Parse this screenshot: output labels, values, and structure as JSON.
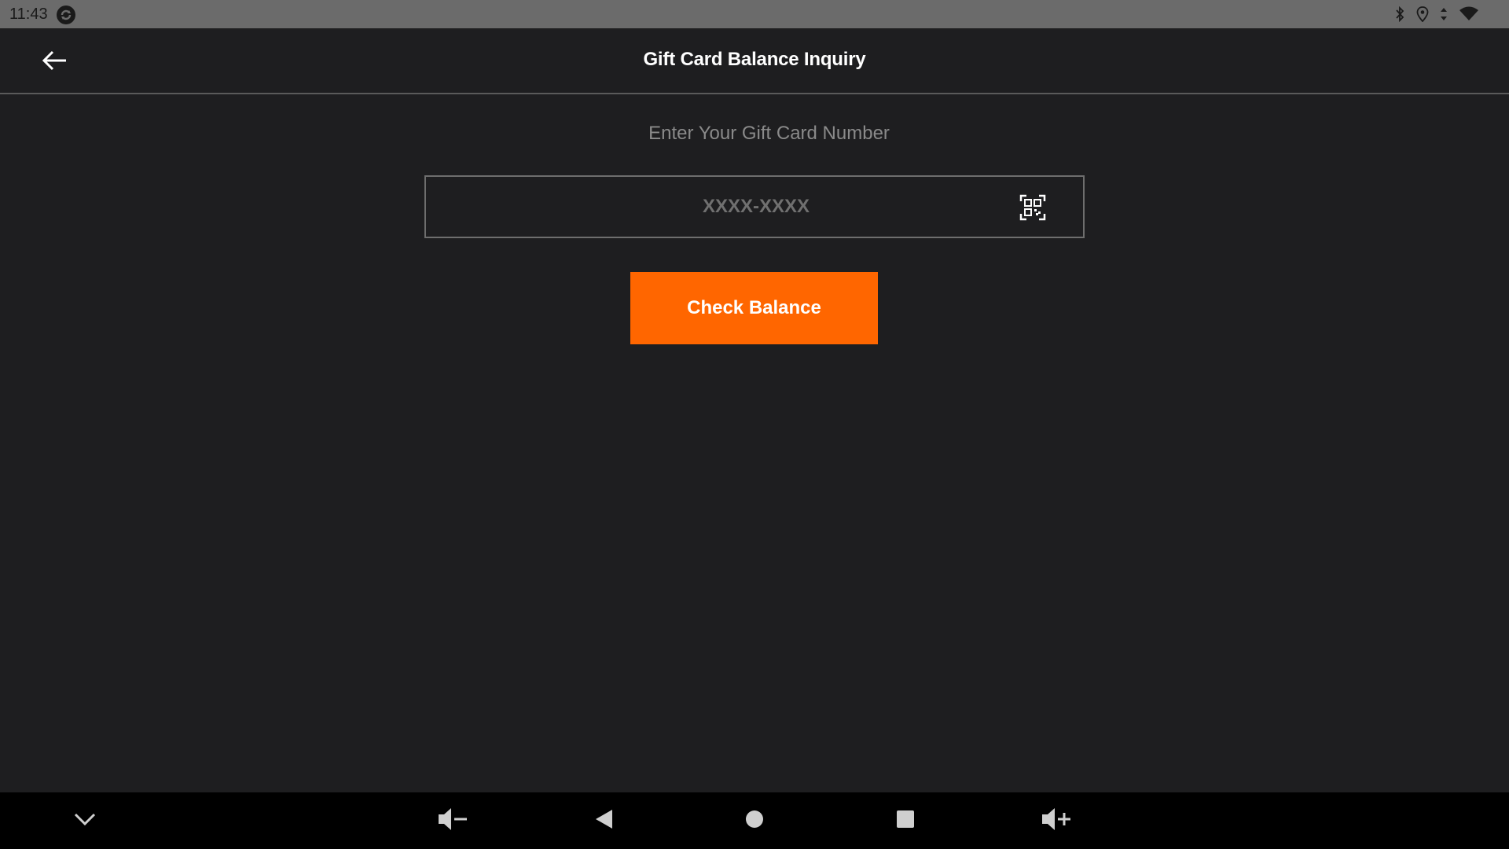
{
  "status_bar": {
    "time": "11:43",
    "icons": [
      "sync-app-icon",
      "bluetooth-icon",
      "location-icon",
      "data-arrows-icon",
      "wifi-icon"
    ]
  },
  "header": {
    "title": "Gift Card Balance Inquiry",
    "back_icon": "arrow-left-icon"
  },
  "form": {
    "prompt": "Enter Your Gift Card Number",
    "card_input": {
      "value": "",
      "placeholder": "XXXX-XXXX"
    },
    "scan_icon": "qr-code-scan-icon",
    "submit_label": "Check Balance"
  },
  "nav_bar": {
    "buttons": [
      "collapse-icon",
      "volume-down-icon",
      "back-triangle-icon",
      "home-circle-icon",
      "recents-square-icon",
      "volume-up-icon"
    ]
  },
  "colors": {
    "background": "#1e1e20",
    "status_bar": "#6b6b6b",
    "accent": "#ff6600",
    "nav_bar": "#000000",
    "title_text": "#ffffff",
    "muted_text": "#8a8a8a"
  }
}
